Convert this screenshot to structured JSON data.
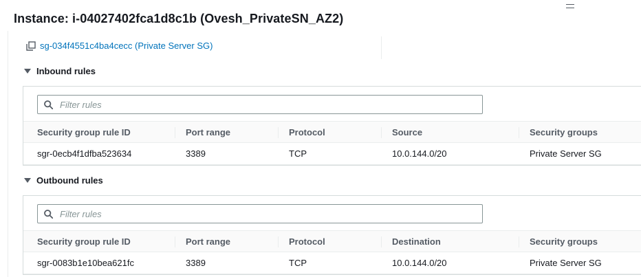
{
  "instance": {
    "title": "Instance: i-04027402fca1d8c1b (Ovesh_PrivateSN_AZ2)"
  },
  "security_group": {
    "link_text": "sg-034f4551c4ba4cecc (Private Server SG)"
  },
  "inbound": {
    "label": "Inbound rules",
    "filter_placeholder": "Filter rules",
    "columns": [
      "Security group rule ID",
      "Port range",
      "Protocol",
      "Source",
      "Security groups"
    ],
    "rows": [
      [
        "sgr-0ecb4f1dfba523634",
        "3389",
        "TCP",
        "10.0.144.0/20",
        "Private Server SG"
      ]
    ]
  },
  "outbound": {
    "label": "Outbound rules",
    "filter_placeholder": "Filter rules",
    "columns": [
      "Security group rule ID",
      "Port range",
      "Protocol",
      "Destination",
      "Security groups"
    ],
    "rows": [
      [
        "sgr-0083b1e10bea621fc",
        "3389",
        "TCP",
        "10.0.144.0/20",
        "Private Server SG"
      ]
    ]
  },
  "icons": {
    "menu": "menu-icon",
    "copy": "copy-icon",
    "caret": "caret-down-icon",
    "search": "search-icon"
  },
  "colors": {
    "link": "#0073bb",
    "text": "#16191f",
    "header_text": "#545b64",
    "border": "#d5dbdb"
  }
}
